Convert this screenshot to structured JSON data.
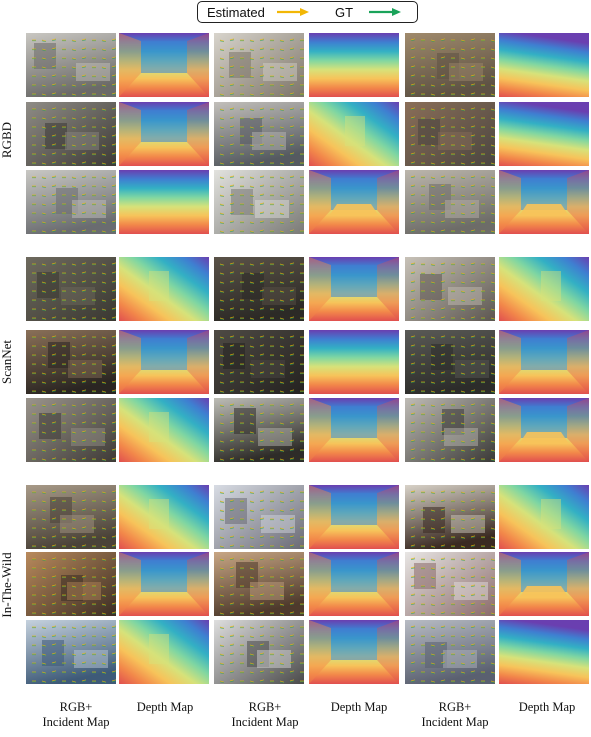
{
  "legend": {
    "estimated_label": "Estimated",
    "gt_label": "GT",
    "estimated_color": "#f2b705",
    "gt_color": "#1aa35a"
  },
  "groups": [
    {
      "label": "RGBD"
    },
    {
      "label": "ScanNet"
    },
    {
      "label": "In-The-Wild"
    }
  ],
  "columns": [
    {
      "line1": "RGB+",
      "line2": "Incident Map"
    },
    {
      "line1": "Depth Map",
      "line2": ""
    },
    {
      "line1": "RGB+",
      "line2": "Incident Map"
    },
    {
      "line1": "Depth Map",
      "line2": ""
    },
    {
      "line1": "RGB+",
      "line2": "Incident Map"
    },
    {
      "line1": "Depth Map",
      "line2": ""
    }
  ],
  "scenes": [
    {
      "group": 0,
      "rgb": [
        "#6b6a68",
        "#c9c7c2"
      ],
      "depth": "room"
    },
    {
      "group": 0,
      "rgb": [
        "#7c7468",
        "#d8d4cc"
      ],
      "depth": "floor"
    },
    {
      "group": 0,
      "rgb": [
        "#5e5244",
        "#a08a6c"
      ],
      "depth": "ceiling"
    },
    {
      "group": 0,
      "rgb": [
        "#3d3a36",
        "#8f8c86"
      ],
      "depth": "room"
    },
    {
      "group": 0,
      "rgb": [
        "#555a60",
        "#c2bfba"
      ],
      "depth": "wall"
    },
    {
      "group": 0,
      "rgb": [
        "#4a4540",
        "#8a6e58"
      ],
      "depth": "ceiling"
    },
    {
      "group": 0,
      "rgb": [
        "#6a6c70",
        "#c9c8c4"
      ],
      "depth": "floor"
    },
    {
      "group": 0,
      "rgb": [
        "#7a7a76",
        "#e2e2de"
      ],
      "depth": "table"
    },
    {
      "group": 0,
      "rgb": [
        "#6d6c68",
        "#bcb6ac"
      ],
      "depth": "table"
    },
    {
      "group": 1,
      "rgb": [
        "#3a3832",
        "#6e6a5e"
      ],
      "depth": "wall"
    },
    {
      "group": 1,
      "rgb": [
        "#2c2a26",
        "#5a5248"
      ],
      "depth": "room"
    },
    {
      "group": 1,
      "rgb": [
        "#5c5650",
        "#c8c2b8"
      ],
      "depth": "wall"
    },
    {
      "group": 1,
      "rgb": [
        "#2a2522",
        "#8a7058"
      ],
      "depth": "room"
    },
    {
      "group": 1,
      "rgb": [
        "#242220",
        "#4e4a44"
      ],
      "depth": "floor"
    },
    {
      "group": 1,
      "rgb": [
        "#2c2c2a",
        "#5a5a56"
      ],
      "depth": "room"
    },
    {
      "group": 1,
      "rgb": [
        "#3e3a36",
        "#9a948c"
      ],
      "depth": "wall"
    },
    {
      "group": 1,
      "rgb": [
        "#2e2c28",
        "#bdbdb6"
      ],
      "depth": "room"
    },
    {
      "group": 1,
      "rgb": [
        "#3a3936",
        "#bfbcb6"
      ],
      "depth": "table"
    },
    {
      "group": 2,
      "rgb": [
        "#4a4238",
        "#a89a88"
      ],
      "depth": "wall"
    },
    {
      "group": 2,
      "rgb": [
        "#6a6a74",
        "#d8dce4"
      ],
      "depth": "room"
    },
    {
      "group": 2,
      "rgb": [
        "#3a2a22",
        "#d8d2c8"
      ],
      "depth": "wall"
    },
    {
      "group": 2,
      "rgb": [
        "#3b2d24",
        "#b98a5c"
      ],
      "depth": "room"
    },
    {
      "group": 2,
      "rgb": [
        "#4e3a2c",
        "#c8a684"
      ],
      "depth": "room"
    },
    {
      "group": 2,
      "rgb": [
        "#8a6a6a",
        "#e8e6e4"
      ],
      "depth": "table"
    },
    {
      "group": 2,
      "rgb": [
        "#3e5a78",
        "#c6d2de"
      ],
      "depth": "wall"
    },
    {
      "group": 2,
      "rgb": [
        "#4a4a4a",
        "#dedede"
      ],
      "depth": "room"
    },
    {
      "group": 2,
      "rgb": [
        "#5a6070",
        "#b8bcc4"
      ],
      "depth": "ceiling"
    }
  ]
}
